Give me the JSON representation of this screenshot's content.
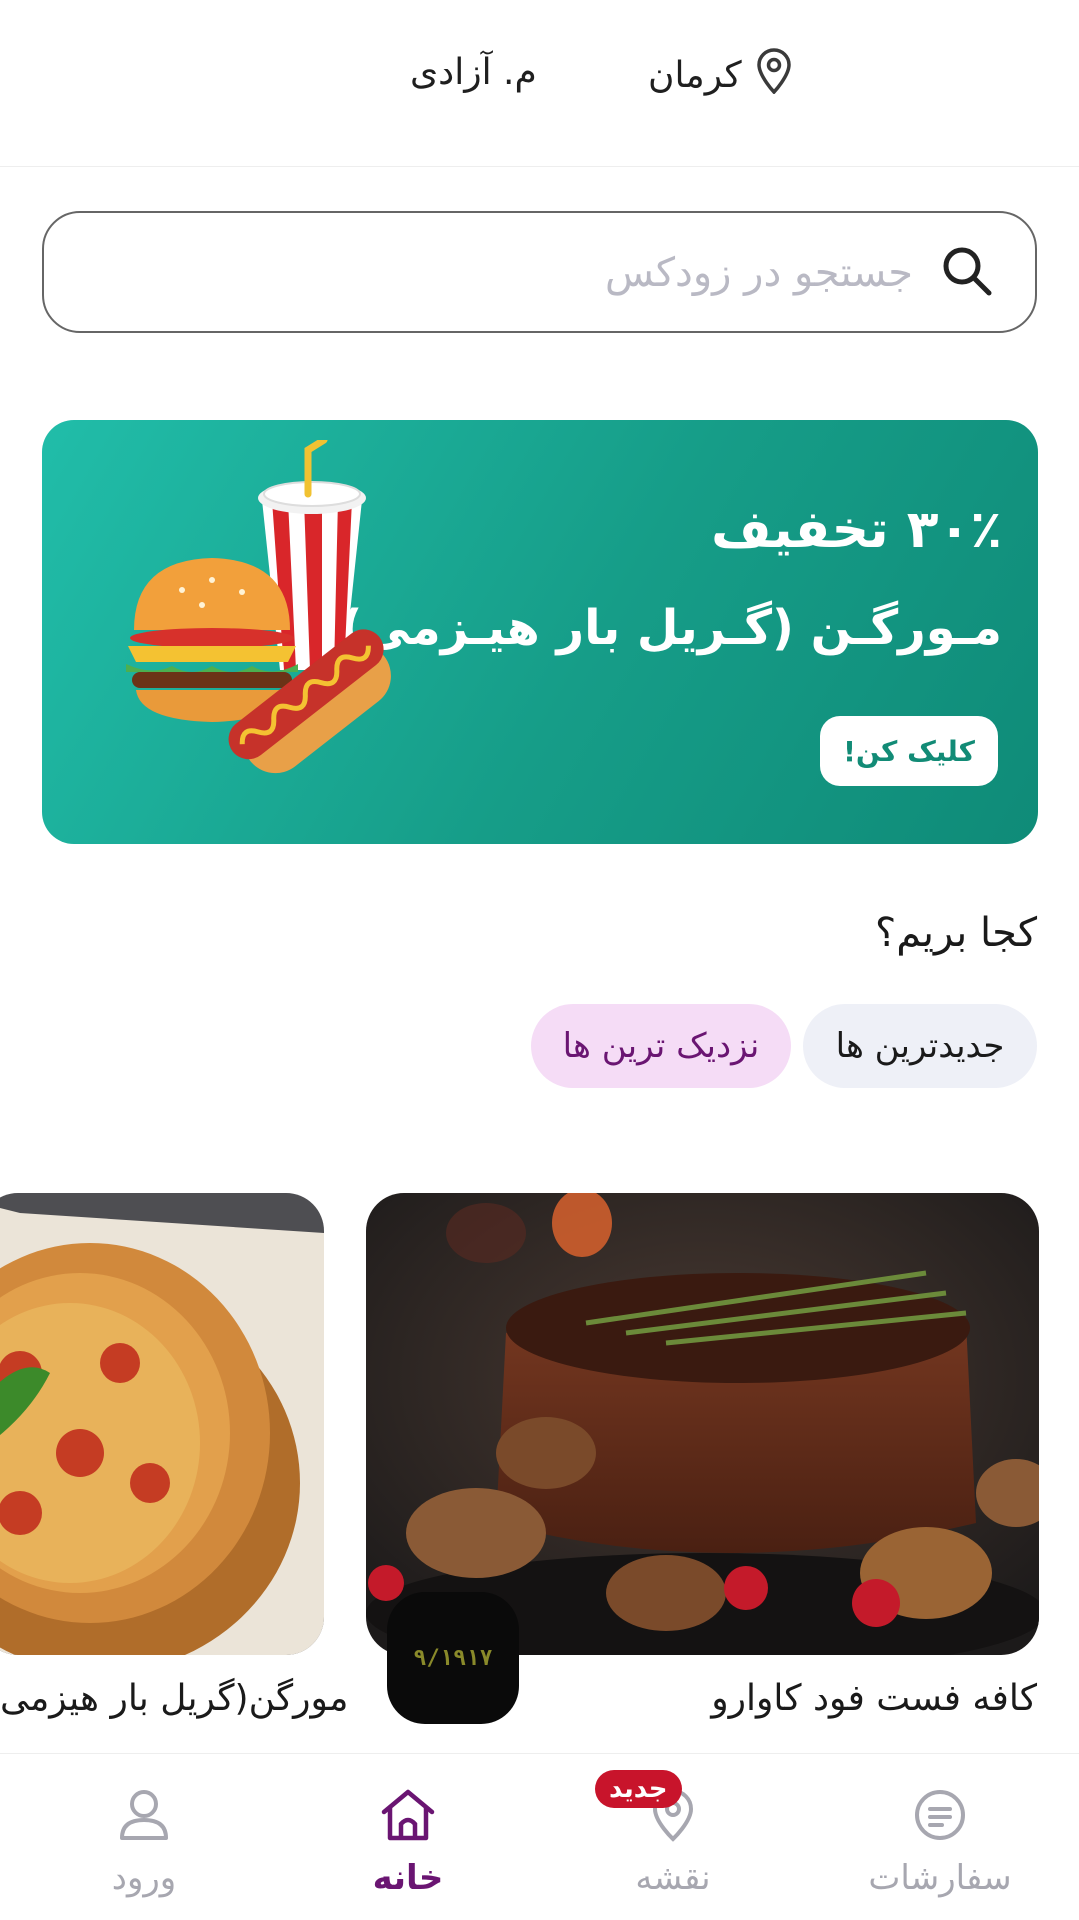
{
  "header": {
    "city": "کرمان",
    "area": "م. آزادی"
  },
  "search": {
    "placeholder": "جستجو در زودکس"
  },
  "banner": {
    "discount": "۳۰٪ تخفیف",
    "title": "مـورگـن (گـریل بار هیـزمی)",
    "cta": "کلیک کن!"
  },
  "section": {
    "title": "کجا بریم؟"
  },
  "chips": [
    {
      "label": "جدیدترین ها"
    },
    {
      "label": "نزدیک ترین ها"
    }
  ],
  "cards": [
    {
      "name": "کافه فست فود کاوارو",
      "logo_text": "۹/۱۹۱۷"
    },
    {
      "name": "مورگن(گریل بار هیزمی"
    }
  ],
  "bottom_nav": {
    "orders": "سفارشات",
    "map": "نقشه",
    "map_badge": "جدید",
    "home": "خانه",
    "login": "ورود"
  },
  "colors": {
    "accent": "#6a1572",
    "banner": "#169d88",
    "badge": "#c8142b"
  }
}
